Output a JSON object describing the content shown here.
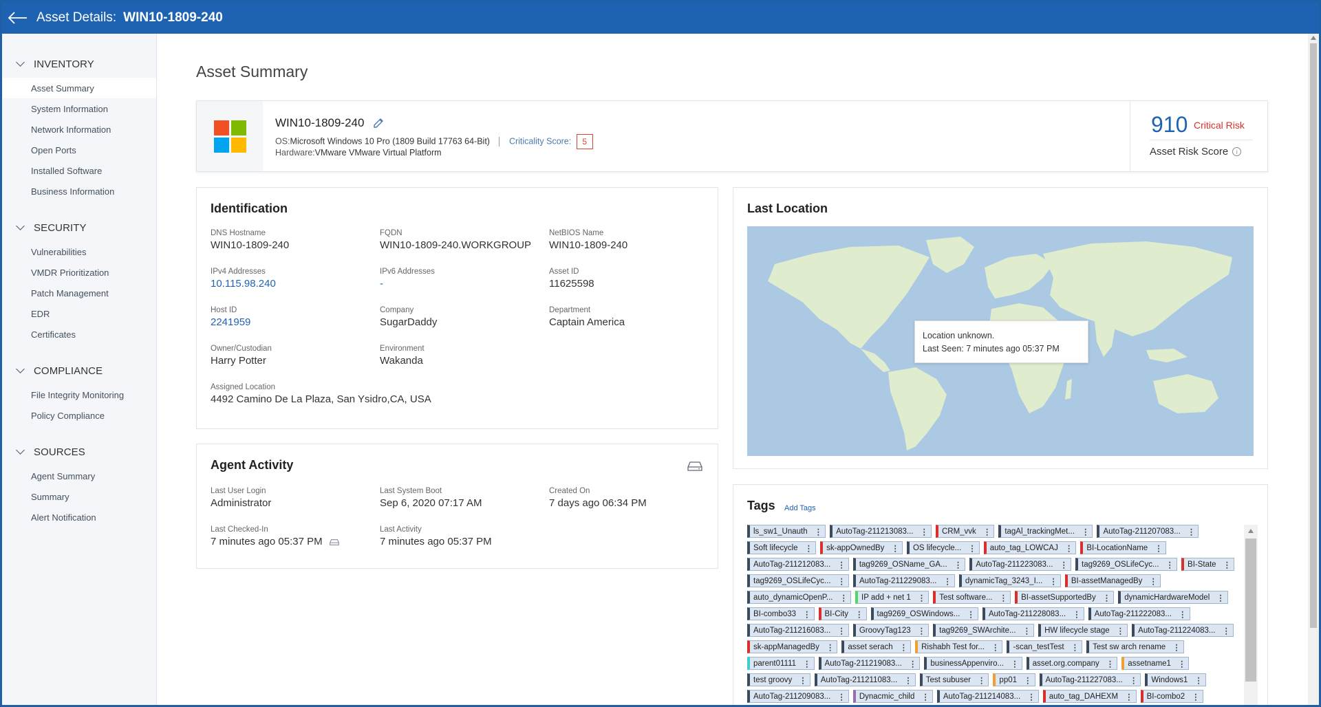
{
  "header": {
    "title": "Asset Details:",
    "asset_name": "WIN10-1809-240"
  },
  "sidebar": {
    "sections": [
      {
        "label": "INVENTORY",
        "items": [
          "Asset Summary",
          "System Information",
          "Network Information",
          "Open Ports",
          "Installed Software",
          "Business Information"
        ]
      },
      {
        "label": "SECURITY",
        "items": [
          "Vulnerabilities",
          "VMDR Prioritization",
          "Patch Management",
          "EDR",
          "Certificates"
        ]
      },
      {
        "label": "COMPLIANCE",
        "items": [
          "File Integrity Monitoring",
          "Policy Compliance"
        ]
      },
      {
        "label": "SOURCES",
        "items": [
          "Agent Summary",
          "Summary",
          "Alert Notification"
        ]
      }
    ],
    "active": "Asset Summary"
  },
  "page_title": "Asset Summary",
  "summary": {
    "name": "WIN10-1809-240",
    "os_label": "OS:",
    "os_value": "Microsoft Windows 10 Pro (1809 Build 17763 64-Bit)",
    "criticality_label": "Criticality Score:",
    "criticality_value": "5",
    "hardware_label": "Hardware:",
    "hardware_value": "VMware VMware Virtual Platform",
    "risk_score": "910",
    "risk_level": "Critical Risk",
    "risk_label": "Asset Risk Score",
    "win_logo_colors": [
      "#f25022",
      "#7fba00",
      "#00a4ef",
      "#ffb900"
    ]
  },
  "identification": {
    "title": "Identification",
    "dns_hostname": {
      "label": "DNS Hostname",
      "value": "WIN10-1809-240"
    },
    "fqdn": {
      "label": "FQDN",
      "value": "WIN10-1809-240.WORKGROUP"
    },
    "netbios": {
      "label": "NetBIOS Name",
      "value": "WIN10-1809-240"
    },
    "ipv4": {
      "label": "IPv4 Addresses",
      "value": "10.115.98.240"
    },
    "ipv6": {
      "label": "IPv6 Addresses",
      "value": "-"
    },
    "asset_id": {
      "label": "Asset ID",
      "value": "11625598"
    },
    "host_id": {
      "label": "Host ID",
      "value": "2241959"
    },
    "company": {
      "label": "Company",
      "value": "SugarDaddy"
    },
    "department": {
      "label": "Department",
      "value": "Captain America"
    },
    "owner": {
      "label": "Owner/Custodian",
      "value": "Harry Potter"
    },
    "environment": {
      "label": "Environment",
      "value": "Wakanda"
    },
    "assigned_location": {
      "label": "Assigned Location",
      "value": "4492 Camino De La Plaza, San Ysidro,CA, USA"
    }
  },
  "agent": {
    "title": "Agent Activity",
    "last_user_login": {
      "label": "Last User Login",
      "value": "Administrator"
    },
    "last_system_boot": {
      "label": "Last System Boot",
      "value": "Sep 6, 2020 07:17 AM"
    },
    "created_on": {
      "label": "Created On",
      "value": "7 days ago 06:34 PM"
    },
    "last_checked_in": {
      "label": "Last Checked-In",
      "value": "7 minutes ago 05:37 PM"
    },
    "last_activity": {
      "label": "Last Activity",
      "value": "7 minutes ago 05:37 PM"
    }
  },
  "location": {
    "title": "Last Location",
    "tooltip_line1": "Location unknown.",
    "tooltip_line2": "Last Seen: 7 minutes ago 05:37 PM"
  },
  "tags": {
    "title": "Tags",
    "add_label": "Add Tags",
    "items": [
      {
        "label": "ls_sw1_Unauth",
        "color": "#3b4a5c"
      },
      {
        "label": "AutoTag-211213083...",
        "color": "#3b4a5c"
      },
      {
        "label": "CRM_vvk",
        "color": "#d9302b"
      },
      {
        "label": "tagAl_trackingMet...",
        "color": "#3b4a5c"
      },
      {
        "label": "AutoTag-211207083...",
        "color": "#3b4a5c"
      },
      {
        "label": "Soft lifecycle",
        "color": "#3b4a5c"
      },
      {
        "label": "sk-appOwnedBy",
        "color": "#d9302b"
      },
      {
        "label": "OS lifecycle...",
        "color": "#3b4a5c"
      },
      {
        "label": "auto_tag_LOWCAJ",
        "color": "#d9302b"
      },
      {
        "label": "BI-LocationName",
        "color": "#d9302b"
      },
      {
        "label": "AutoTag-211212083...",
        "color": "#3b4a5c"
      },
      {
        "label": "tag9269_OSName_GA...",
        "color": "#3b4a5c"
      },
      {
        "label": "AutoTag-211223083...",
        "color": "#3b4a5c"
      },
      {
        "label": "tag9269_OSLifeCyc...",
        "color": "#3b4a5c"
      },
      {
        "label": "BI-State",
        "color": "#d9302b"
      },
      {
        "label": "tag9269_OSLifeCyc...",
        "color": "#3b4a5c"
      },
      {
        "label": "AutoTag-211229083...",
        "color": "#3b4a5c"
      },
      {
        "label": "dynamicTag_3243_I...",
        "color": "#3b4a5c"
      },
      {
        "label": "BI-assetManagedBy",
        "color": "#d9302b"
      },
      {
        "label": "auto_dynamicOpenP...",
        "color": "#3b4a5c"
      },
      {
        "label": "IP add + net 1",
        "color": "#4cd964"
      },
      {
        "label": "Test software...",
        "color": "#d9302b"
      },
      {
        "label": "BI-assetSupportedBy",
        "color": "#d9302b"
      },
      {
        "label": "dynamicHardwareModel",
        "color": "#3b4a5c"
      },
      {
        "label": "BI-combo33",
        "color": "#3b4a5c"
      },
      {
        "label": "BI-City",
        "color": "#d9302b"
      },
      {
        "label": "tag9269_OSWindows...",
        "color": "#3b4a5c"
      },
      {
        "label": "AutoTag-211228083...",
        "color": "#3b4a5c"
      },
      {
        "label": "AutoTag-211222083...",
        "color": "#3b4a5c"
      },
      {
        "label": "AutoTag-211216083...",
        "color": "#3b4a5c"
      },
      {
        "label": "GroovyTag123",
        "color": "#3b4a5c"
      },
      {
        "label": "tag9269_SWArchite...",
        "color": "#3b4a5c"
      },
      {
        "label": "HW lifecycle stage",
        "color": "#3b4a5c"
      },
      {
        "label": "AutoTag-211224083...",
        "color": "#3b4a5c"
      },
      {
        "label": "sk-appManagedBy",
        "color": "#d9302b"
      },
      {
        "label": "asset serach",
        "color": "#3b4a5c"
      },
      {
        "label": "Rishabh Test for...",
        "color": "#f0a030"
      },
      {
        "label": "-scan_testTest",
        "color": "#3b4a5c"
      },
      {
        "label": "Test sw arch rename",
        "color": "#3b4a5c"
      },
      {
        "label": "parent01111",
        "color": "#3ccfcf"
      },
      {
        "label": "AutoTag-211219083...",
        "color": "#3b4a5c"
      },
      {
        "label": "businessAppenviro...",
        "color": "#3b4a5c"
      },
      {
        "label": "asset.org.company",
        "color": "#3b4a5c"
      },
      {
        "label": "assetname1",
        "color": "#f0a030"
      },
      {
        "label": "test groovy",
        "color": "#3b4a5c"
      },
      {
        "label": "AutoTag-211211083...",
        "color": "#3b4a5c"
      },
      {
        "label": "Test subuser",
        "color": "#3b4a5c"
      },
      {
        "label": "pp01",
        "color": "#f0a030"
      },
      {
        "label": "AutoTag-211227083...",
        "color": "#3b4a5c"
      },
      {
        "label": "Windows1",
        "color": "#3b4a5c"
      },
      {
        "label": "AutoTag-211209083...",
        "color": "#3b4a5c"
      },
      {
        "label": "Dynacmic_child",
        "color": "#9b6bb0"
      },
      {
        "label": "AutoTag-211214083...",
        "color": "#3b4a5c"
      },
      {
        "label": "auto_tag_DAHEXM",
        "color": "#d9302b"
      },
      {
        "label": "BI-combo2",
        "color": "#d9302b"
      }
    ]
  }
}
